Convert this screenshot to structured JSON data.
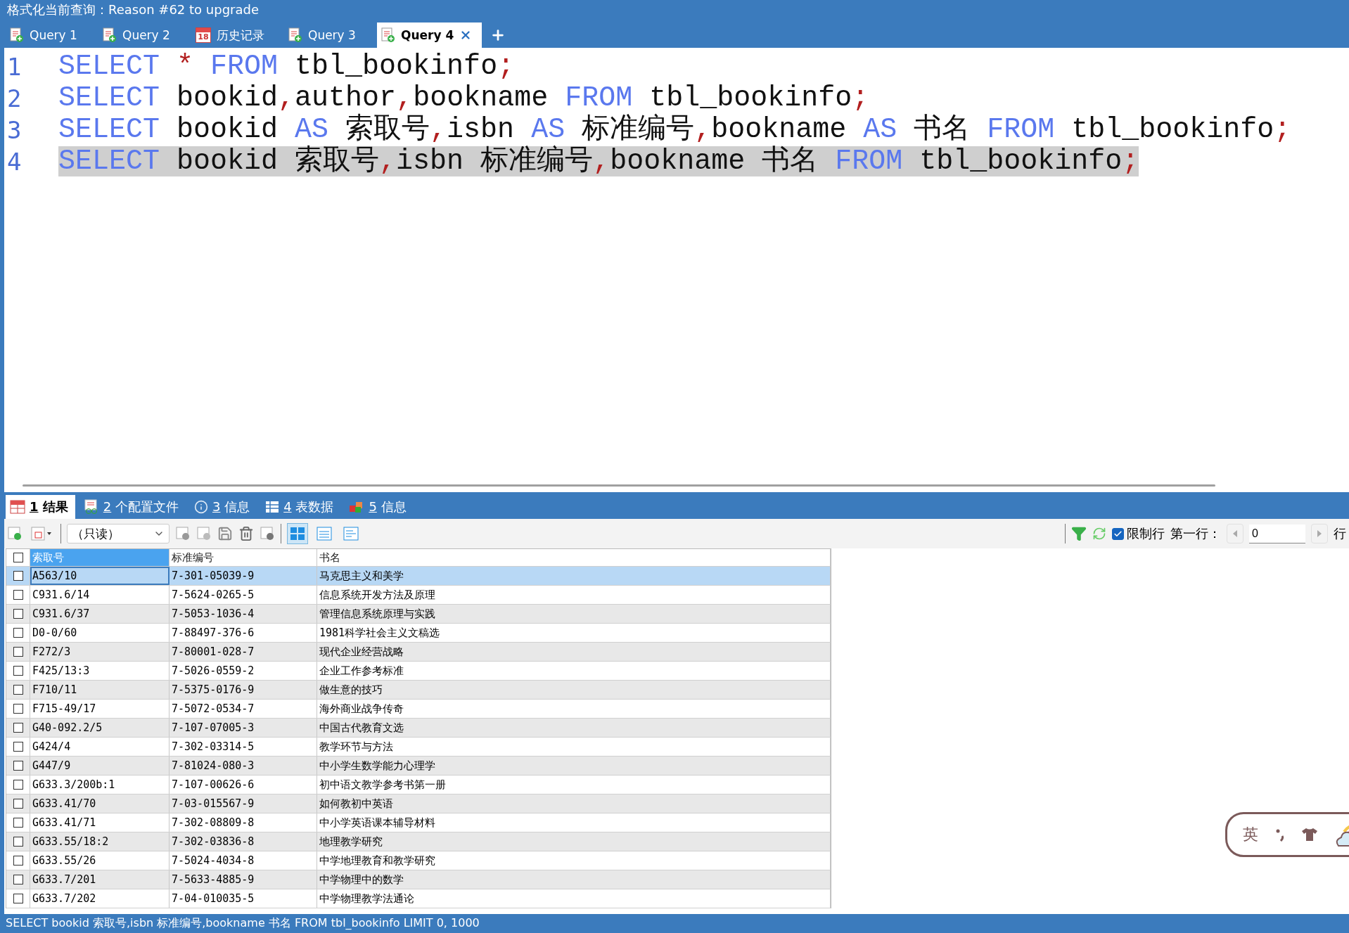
{
  "window": {
    "title": "格式化当前查询：Reason #62 to upgrade"
  },
  "query_tabs": [
    {
      "kind": "query",
      "label": "Query 1",
      "selected": false
    },
    {
      "kind": "query",
      "label": "Query 2",
      "selected": false
    },
    {
      "kind": "history",
      "label": "历史记录",
      "icon_text": "18",
      "selected": false
    },
    {
      "kind": "query",
      "label": "Query 3",
      "selected": false
    },
    {
      "kind": "query",
      "label": "Query 4",
      "selected": true
    }
  ],
  "editor": {
    "lines": [
      {
        "number": "1",
        "selected": false,
        "tokens": [
          {
            "text": "SELECT",
            "kind": "keyword"
          },
          {
            "text": " *",
            "kind": "symbol"
          },
          {
            "text": " FROM",
            "kind": "keyword"
          },
          {
            "text": " tbl_bookinfo",
            "kind": "plain"
          },
          {
            "text": ";",
            "kind": "symbol"
          }
        ]
      },
      {
        "number": "2",
        "selected": false,
        "tokens": [
          {
            "text": "SELECT",
            "kind": "keyword"
          },
          {
            "text": " bookid",
            "kind": "plain"
          },
          {
            "text": ",",
            "kind": "symbol"
          },
          {
            "text": "author",
            "kind": "plain"
          },
          {
            "text": ",",
            "kind": "symbol"
          },
          {
            "text": "bookname",
            "kind": "plain"
          },
          {
            "text": " FROM",
            "kind": "keyword"
          },
          {
            "text": " tbl_bookinfo",
            "kind": "plain"
          },
          {
            "text": ";",
            "kind": "symbol"
          }
        ]
      },
      {
        "number": "3",
        "selected": false,
        "tokens": [
          {
            "text": "SELECT",
            "kind": "keyword"
          },
          {
            "text": " bookid",
            "kind": "plain"
          },
          {
            "text": " AS",
            "kind": "keyword"
          },
          {
            "text": " 索取号",
            "kind": "plain"
          },
          {
            "text": ",",
            "kind": "symbol"
          },
          {
            "text": "isbn",
            "kind": "plain"
          },
          {
            "text": " AS",
            "kind": "keyword"
          },
          {
            "text": " 标准编号",
            "kind": "plain"
          },
          {
            "text": ",",
            "kind": "symbol"
          },
          {
            "text": "bookname",
            "kind": "plain"
          },
          {
            "text": " AS",
            "kind": "keyword"
          },
          {
            "text": " 书名",
            "kind": "plain"
          },
          {
            "text": " FROM",
            "kind": "keyword"
          },
          {
            "text": " tbl_bookinfo",
            "kind": "plain"
          },
          {
            "text": ";",
            "kind": "symbol"
          }
        ]
      },
      {
        "number": "4",
        "selected": true,
        "tokens": [
          {
            "text": "SELECT",
            "kind": "keyword"
          },
          {
            "text": " bookid 索取号",
            "kind": "plain"
          },
          {
            "text": ",",
            "kind": "symbol"
          },
          {
            "text": "isbn 标准编号",
            "kind": "plain"
          },
          {
            "text": ",",
            "kind": "symbol"
          },
          {
            "text": "bookname 书名",
            "kind": "plain"
          },
          {
            "text": " FROM",
            "kind": "keyword"
          },
          {
            "text": " tbl_bookinfo",
            "kind": "plain"
          },
          {
            "text": ";",
            "kind": "symbol"
          }
        ]
      }
    ]
  },
  "result_tabs": [
    {
      "kind": "result",
      "number": "1",
      "label": "结果",
      "selected": true
    },
    {
      "kind": "profile",
      "number": "2",
      "label": "个配置文件",
      "selected": false
    },
    {
      "kind": "info",
      "number": "3",
      "label": "信息",
      "selected": false
    },
    {
      "kind": "tabledata",
      "number": "4",
      "label": "表数据",
      "selected": false
    },
    {
      "kind": "blocks",
      "number": "5",
      "label": "信息",
      "selected": false
    }
  ],
  "toolbar": {
    "mode_select": "（只读）",
    "views": [
      {
        "kind": "grid",
        "selected": true
      },
      {
        "kind": "form",
        "selected": false
      },
      {
        "kind": "text",
        "selected": false
      }
    ],
    "limit_rows": {
      "label": "限制行",
      "checked": true
    },
    "first_row_label": "第一行：",
    "first_row_value": "0",
    "rows_label": "行"
  },
  "table": {
    "header_checked": false,
    "columns": [
      {
        "label": "索取号",
        "selected": true
      },
      {
        "label": "标准编号",
        "selected": false
      },
      {
        "label": "书名",
        "selected": false
      }
    ],
    "rows": [
      {
        "selected": true,
        "checked": false,
        "cells": [
          "A563/10",
          "7-301-05039-9",
          "马克思主义和美学"
        ]
      },
      {
        "selected": false,
        "checked": false,
        "cells": [
          "C931.6/14",
          "7-5624-0265-5",
          "信息系统开发方法及原理"
        ]
      },
      {
        "selected": false,
        "checked": false,
        "cells": [
          "C931.6/37",
          "7-5053-1036-4",
          "管理信息系统原理与实践"
        ]
      },
      {
        "selected": false,
        "checked": false,
        "cells": [
          "D0-0/60",
          "7-88497-376-6",
          "1981科学社会主义文稿选"
        ]
      },
      {
        "selected": false,
        "checked": false,
        "cells": [
          "F272/3",
          "7-80001-028-7",
          "现代企业经营战略"
        ]
      },
      {
        "selected": false,
        "checked": false,
        "cells": [
          "F425/13:3",
          "7-5026-0559-2",
          "企业工作参考标准"
        ]
      },
      {
        "selected": false,
        "checked": false,
        "cells": [
          "F710/11",
          "7-5375-0176-9",
          "做生意的技巧"
        ]
      },
      {
        "selected": false,
        "checked": false,
        "cells": [
          "F715-49/17",
          "7-5072-0534-7",
          "海外商业战争传奇"
        ]
      },
      {
        "selected": false,
        "checked": false,
        "cells": [
          "G40-092.2/5",
          "7-107-07005-3",
          "中国古代教育文选"
        ]
      },
      {
        "selected": false,
        "checked": false,
        "cells": [
          "G424/4",
          "7-302-03314-5",
          "教学环节与方法"
        ]
      },
      {
        "selected": false,
        "checked": false,
        "cells": [
          "G447/9",
          "7-81024-080-3",
          "中小学生数学能力心理学"
        ]
      },
      {
        "selected": false,
        "checked": false,
        "cells": [
          "G633.3/200b:1",
          "7-107-00626-6",
          "初中语文教学参考书第一册"
        ]
      },
      {
        "selected": false,
        "checked": false,
        "cells": [
          "G633.41/70",
          "7-03-015567-9",
          "如何教初中英语"
        ]
      },
      {
        "selected": false,
        "checked": false,
        "cells": [
          "G633.41/71",
          "7-302-08809-8",
          "中小学英语课本辅导材料"
        ]
      },
      {
        "selected": false,
        "checked": false,
        "cells": [
          "G633.55/18:2",
          "7-302-03836-8",
          "地理教学研究"
        ]
      },
      {
        "selected": false,
        "checked": false,
        "cells": [
          "G633.55/26",
          "7-5024-4034-8",
          "中学地理教育和教学研究"
        ]
      },
      {
        "selected": false,
        "checked": false,
        "cells": [
          "G633.7/201",
          "7-5633-4885-9",
          "中学物理中的数学"
        ]
      },
      {
        "selected": false,
        "checked": false,
        "cells": [
          "G633.7/202",
          "7-04-010035-5",
          "中学物理教学法通论"
        ]
      }
    ]
  },
  "ime_bar": {
    "language": "英"
  },
  "status_bar": {
    "text": "SELECT bookid 索取号,isbn 标准编号,bookname 书名 FROM tbl_bookinfo LIMIT 0, 1000"
  }
}
